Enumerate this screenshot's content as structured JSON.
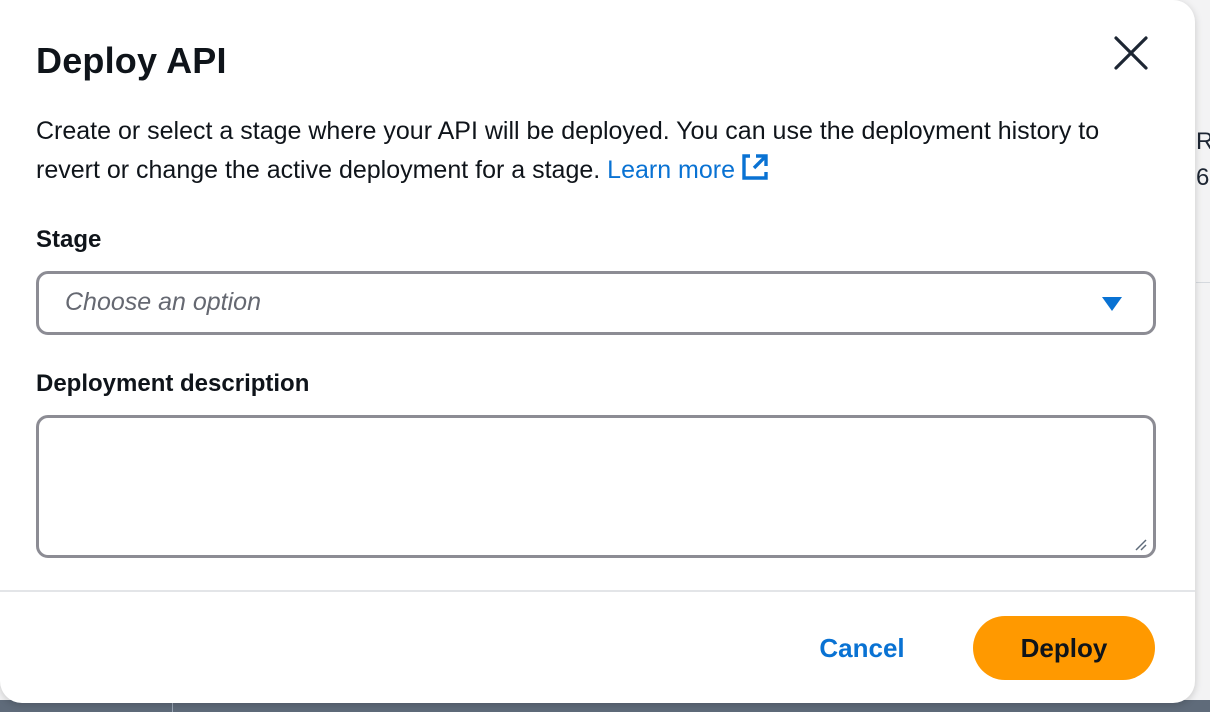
{
  "background": {
    "peek_top": "Re",
    "peek_bottom": "6"
  },
  "modal": {
    "title": "Deploy API",
    "description": "Create or select a stage where your API will be deployed. You can use the deployment history to revert or change the active deployment for a stage.",
    "learn_more": "Learn more",
    "stage": {
      "label": "Stage",
      "placeholder": "Choose an option",
      "value": ""
    },
    "deployment_description": {
      "label": "Deployment description",
      "value": ""
    },
    "footer": {
      "cancel_label": "Cancel",
      "deploy_label": "Deploy"
    }
  },
  "colors": {
    "primary_button": "#ff9900",
    "link": "#0972d3",
    "text": "#0f141a",
    "border": "#8c8c94"
  },
  "icons": {
    "close": "close-icon",
    "external_link": "external-link-icon",
    "dropdown": "caret-down-icon",
    "resize": "resize-handle-icon"
  }
}
